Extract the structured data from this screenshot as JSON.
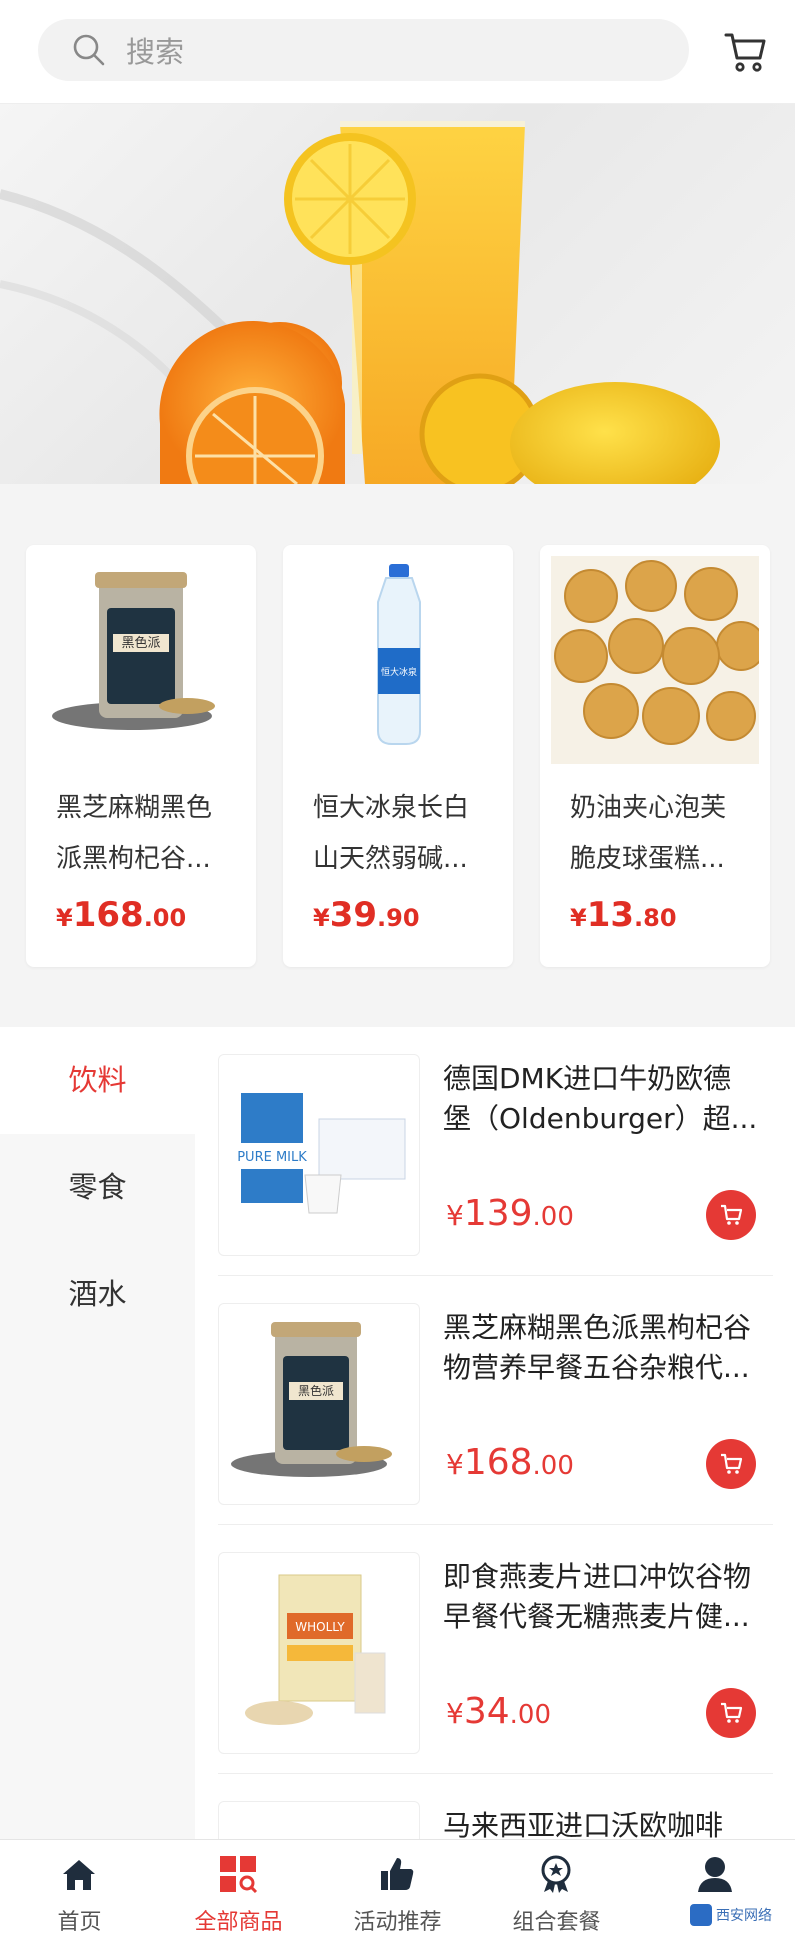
{
  "search": {
    "placeholder": "搜索"
  },
  "header": {
    "cart_icon": "shopping-cart-icon"
  },
  "featured": [
    {
      "name_line1": "黑芝麻糊黑色",
      "name_line2": "派黑枸杞谷...",
      "price_cur": "¥",
      "price_int": "168",
      "price_dec": ".00"
    },
    {
      "name_line1": "恒大冰泉长白",
      "name_line2": "山天然弱碱...",
      "price_cur": "¥",
      "price_int": "39",
      "price_dec": ".90"
    },
    {
      "name_line1": "奶油夹心泡芙",
      "name_line2": "脆皮球蛋糕...",
      "price_cur": "¥",
      "price_int": "13",
      "price_dec": ".80"
    }
  ],
  "categories": [
    {
      "label": "饮料",
      "active": true
    },
    {
      "label": "零食",
      "active": false
    },
    {
      "label": "酒水",
      "active": false
    }
  ],
  "products": [
    {
      "title_line1": "德国DMK进口牛奶欧德",
      "title_line2": "堡（Oldenburger）超...",
      "price_cur": "¥",
      "price_int": "139",
      "price_dec": ".00"
    },
    {
      "title_line1": "黑芝麻糊黑色派黑枸杞谷",
      "title_line2": "物营养早餐五谷杂粮代...",
      "price_cur": "¥",
      "price_int": "168",
      "price_dec": ".00"
    },
    {
      "title_line1": "即食燕麦片进口冲饮谷物",
      "title_line2": "早餐代餐无糖燕麦片健...",
      "price_cur": "¥",
      "price_int": "34",
      "price_dec": ".00"
    },
    {
      "title_line1": "马来西亚进口沃欧咖啡",
      "title_line2": "",
      "price_cur": "",
      "price_int": "",
      "price_dec": ""
    }
  ],
  "tabs": [
    {
      "label": "首页",
      "icon": "home-icon",
      "active": false
    },
    {
      "label": "全部商品",
      "icon": "all-goods-icon",
      "active": true
    },
    {
      "label": "活动推荐",
      "icon": "thumbs-up-icon",
      "active": false
    },
    {
      "label": "组合套餐",
      "icon": "award-icon",
      "active": false
    },
    {
      "label": "",
      "icon": "user-icon",
      "active": false
    }
  ],
  "watermark": {
    "text": "西安网络"
  },
  "colors": {
    "accent": "#e53935",
    "price": "#e02e24",
    "background": "#f4f4f4"
  }
}
